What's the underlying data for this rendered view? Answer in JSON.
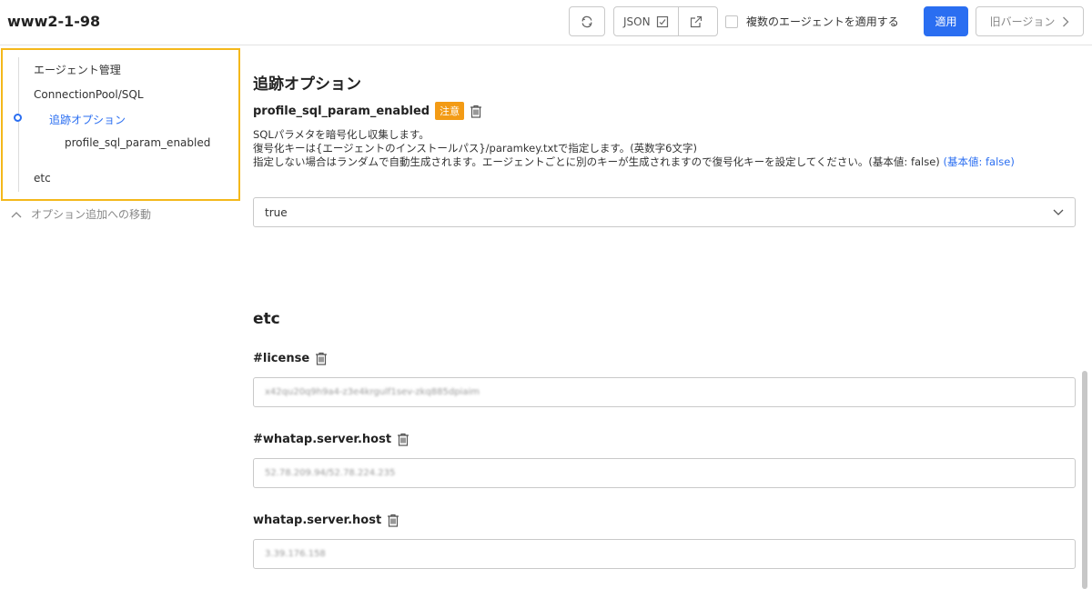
{
  "header": {
    "title": "www2-1-98",
    "json_label": "JSON",
    "multi_agent_label": "複数のエージェントを適用する",
    "apply_label": "適用",
    "old_version_label": "旧バージョン"
  },
  "sidebar": {
    "items": [
      {
        "label": "エージェント管理"
      },
      {
        "label": "ConnectionPool/SQL"
      },
      {
        "label": "追跡オプション"
      },
      {
        "label": "profile_sql_param_enabled"
      },
      {
        "label": "etc"
      }
    ],
    "move_link": "オプション追加への移動"
  },
  "main": {
    "section1": {
      "title": "追跡オプション",
      "param": {
        "name": "profile_sql_param_enabled",
        "badge": "注意",
        "desc_line1": "SQLパラメタを暗号化し収集します。",
        "desc_line2": "復号化キーは{エージェントのインストールパス}/paramkey.txtで指定します。(英数字6文字)",
        "desc_line3": "指定しない場合はランダムで自動生成されます。エージェントごとに別のキーが生成されますので復号化キーを設定してください。(基本値: false)",
        "desc_default": "(基本値: false)",
        "value": "true"
      }
    },
    "section2": {
      "title": "etc",
      "fields": [
        {
          "name": "#license",
          "value": "x42qu20q9h9a4-z3e4krgulf1sev-zkq885dpiaim"
        },
        {
          "name": "#whatap.server.host",
          "value": "52.78.209.94/52.78.224.235"
        },
        {
          "name": "whatap.server.host",
          "value": "3.39.176.158"
        }
      ]
    }
  },
  "colors": {
    "accent": "#2a6ef1",
    "badge": "#f39b15",
    "highlight_border": "#f4b81b"
  }
}
